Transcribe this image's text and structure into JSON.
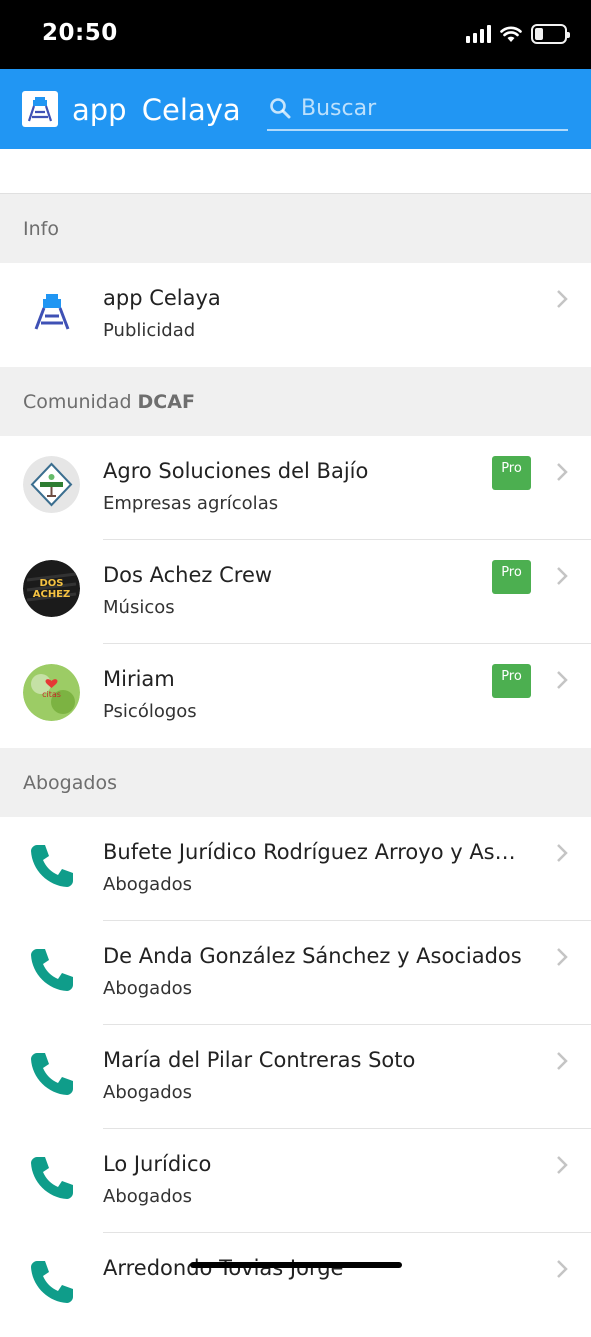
{
  "status_bar": {
    "time": "20:50"
  },
  "app_bar": {
    "title": "app  Celaya",
    "search_placeholder": "Buscar"
  },
  "sections": {
    "info": {
      "header": "Info",
      "items": [
        {
          "title": "app Celaya",
          "subtitle": "Publicidad"
        }
      ]
    },
    "comunidad": {
      "header_prefix": "Comunidad",
      "header_bold": "DCAF",
      "items": [
        {
          "title": "Agro Soluciones del Bajío",
          "subtitle": "Empresas agrícolas",
          "badge": "Pro"
        },
        {
          "title": "Dos Achez Crew",
          "subtitle": "Músicos",
          "badge": "Pro"
        },
        {
          "title": "Miriam",
          "subtitle": "Psicólogos",
          "badge": "Pro"
        }
      ]
    },
    "abogados": {
      "header": "Abogados",
      "items": [
        {
          "title": "Bufete Jurídico Rodríguez Arroyo y Asoc…",
          "subtitle": "Abogados"
        },
        {
          "title": "De Anda González Sánchez y Asociados",
          "subtitle": "Abogados"
        },
        {
          "title": "María del Pilar Contreras Soto",
          "subtitle": "Abogados"
        },
        {
          "title": "Lo Jurídico",
          "subtitle": "Abogados"
        },
        {
          "title": "Arredondo Tovias Jorge",
          "subtitle": ""
        }
      ]
    }
  },
  "colors": {
    "app_bar": "#2196f3",
    "pro_badge": "#4caf50",
    "phone_icon": "#0f9d8a",
    "section_header_bg": "#f0f0f0"
  },
  "icons": {
    "phone": "phone-icon",
    "chevron": "chevron-right-icon",
    "search": "search-icon",
    "logo": "water-tower-logo"
  }
}
